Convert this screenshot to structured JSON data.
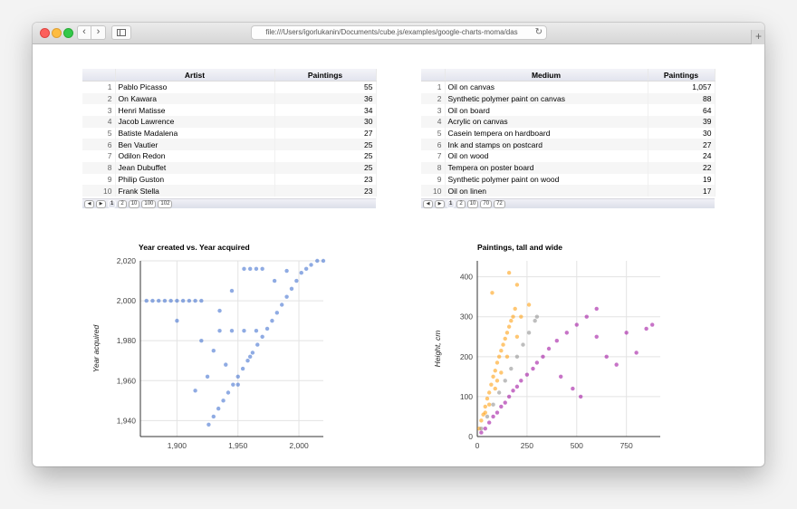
{
  "browser": {
    "url": "file:///Users/igorlukanin/Documents/cube.js/examples/google-charts-moma/das",
    "reload_icon": "reload-icon",
    "new_tab_symbol": "+"
  },
  "artist_table": {
    "headers": [
      "",
      "Artist",
      "Paintings"
    ],
    "rows": [
      [
        "1",
        "Pablo Picasso",
        "55"
      ],
      [
        "2",
        "On Kawara",
        "36"
      ],
      [
        "3",
        "Henri Matisse",
        "34"
      ],
      [
        "4",
        "Jacob Lawrence",
        "30"
      ],
      [
        "5",
        "Batiste Madalena",
        "27"
      ],
      [
        "6",
        "Ben Vautier",
        "25"
      ],
      [
        "7",
        "Odilon Redon",
        "25"
      ],
      [
        "8",
        "Jean Dubuffet",
        "25"
      ],
      [
        "9",
        "Philip Guston",
        "23"
      ],
      [
        "10",
        "Frank Stella",
        "23"
      ]
    ],
    "pages": [
      "1",
      "2",
      "10",
      "100",
      "102"
    ]
  },
  "medium_table": {
    "headers": [
      "",
      "Medium",
      "Paintings"
    ],
    "rows": [
      [
        "1",
        "Oil on canvas",
        "1,057"
      ],
      [
        "2",
        "Synthetic polymer paint on canvas",
        "88"
      ],
      [
        "3",
        "Oil on board",
        "64"
      ],
      [
        "4",
        "Acrylic on canvas",
        "39"
      ],
      [
        "5",
        "Casein tempera on hardboard",
        "30"
      ],
      [
        "6",
        "Ink and stamps on postcard",
        "27"
      ],
      [
        "7",
        "Oil on wood",
        "24"
      ],
      [
        "8",
        "Tempera on poster board",
        "22"
      ],
      [
        "9",
        "Synthetic polymer paint on wood",
        "19"
      ],
      [
        "10",
        "Oil on linen",
        "17"
      ]
    ],
    "pages": [
      "1",
      "2",
      "10",
      "70",
      "72"
    ]
  },
  "chart_data": [
    {
      "type": "scatter",
      "title": "Year created vs. Year acquired",
      "xlabel": "",
      "ylabel": "Year acquired",
      "xlim": [
        1870,
        2020
      ],
      "ylim": [
        1932,
        2020
      ],
      "xticks": [
        "1,900",
        "1,950",
        "2,000"
      ],
      "xtick_values": [
        1900,
        1950,
        2000
      ],
      "yticks": [
        "1,940",
        "1,960",
        "1,980",
        "2,000",
        "2,020"
      ],
      "ytick_values": [
        1940,
        1960,
        1980,
        2000,
        2020
      ],
      "grid": true,
      "color": "#3366cc",
      "series": [
        {
          "points": [
            [
              1875,
              2000
            ],
            [
              1880,
              2000
            ],
            [
              1885,
              2000
            ],
            [
              1890,
              2000
            ],
            [
              1895,
              2000
            ],
            [
              1900,
              2000
            ],
            [
              1905,
              2000
            ],
            [
              1910,
              2000
            ],
            [
              1915,
              2000
            ],
            [
              1920,
              2000
            ],
            [
              1926,
              1938
            ],
            [
              1930,
              1942
            ],
            [
              1934,
              1946
            ],
            [
              1938,
              1950
            ],
            [
              1942,
              1954
            ],
            [
              1946,
              1958
            ],
            [
              1950,
              1962
            ],
            [
              1954,
              1966
            ],
            [
              1958,
              1970
            ],
            [
              1962,
              1974
            ],
            [
              1966,
              1978
            ],
            [
              1970,
              1982
            ],
            [
              1974,
              1986
            ],
            [
              1978,
              1990
            ],
            [
              1982,
              1994
            ],
            [
              1986,
              1998
            ],
            [
              1990,
              2002
            ],
            [
              1994,
              2006
            ],
            [
              1998,
              2010
            ],
            [
              2002,
              2014
            ],
            [
              2006,
              2016
            ],
            [
              2010,
              2018
            ],
            [
              2015,
              2020
            ],
            [
              2020,
              2020
            ],
            [
              1955,
              2016
            ],
            [
              1960,
              2016
            ],
            [
              1965,
              2016
            ],
            [
              1970,
              2016
            ],
            [
              1935,
              1985
            ],
            [
              1945,
              1985
            ],
            [
              1955,
              1985
            ],
            [
              1965,
              1985
            ],
            [
              1930,
              1975
            ],
            [
              1940,
              1968
            ],
            [
              1950,
              1958
            ],
            [
              1960,
              1972
            ],
            [
              1915,
              1955
            ],
            [
              1925,
              1962
            ],
            [
              1935,
              1995
            ],
            [
              1980,
              2010
            ],
            [
              1990,
              2015
            ],
            [
              1945,
              2005
            ],
            [
              1920,
              1980
            ],
            [
              1900,
              1990
            ]
          ]
        }
      ]
    },
    {
      "type": "scatter",
      "title": "Paintings, tall and wide",
      "xlabel": "",
      "ylabel": "Height, cm",
      "xlim": [
        0,
        920
      ],
      "ylim": [
        0,
        440
      ],
      "xticks": [
        "0",
        "250",
        "500",
        "750"
      ],
      "xtick_values": [
        0,
        250,
        500,
        750
      ],
      "yticks": [
        "0",
        "100",
        "200",
        "300",
        "400"
      ],
      "ytick_values": [
        0,
        100,
        200,
        300,
        400
      ],
      "grid": true,
      "series": [
        {
          "color": "#ff9900",
          "points": [
            [
              10,
              20
            ],
            [
              20,
              40
            ],
            [
              30,
              55
            ],
            [
              40,
              75
            ],
            [
              50,
              95
            ],
            [
              60,
              110
            ],
            [
              70,
              130
            ],
            [
              80,
              150
            ],
            [
              90,
              165
            ],
            [
              100,
              185
            ],
            [
              110,
              200
            ],
            [
              120,
              215
            ],
            [
              130,
              230
            ],
            [
              140,
              245
            ],
            [
              150,
              260
            ],
            [
              160,
              275
            ],
            [
              170,
              290
            ],
            [
              180,
              300
            ],
            [
              190,
              320
            ],
            [
              100,
              140
            ],
            [
              150,
              200
            ],
            [
              200,
              250
            ],
            [
              90,
              120
            ],
            [
              60,
              80
            ],
            [
              120,
              160
            ],
            [
              75,
              360
            ],
            [
              160,
              410
            ],
            [
              220,
              300
            ],
            [
              260,
              330
            ],
            [
              200,
              380
            ],
            [
              40,
              60
            ]
          ]
        },
        {
          "color": "#990099",
          "points": [
            [
              20,
              10
            ],
            [
              40,
              20
            ],
            [
              60,
              35
            ],
            [
              80,
              50
            ],
            [
              100,
              60
            ],
            [
              120,
              75
            ],
            [
              140,
              85
            ],
            [
              160,
              100
            ],
            [
              180,
              115
            ],
            [
              200,
              125
            ],
            [
              220,
              140
            ],
            [
              250,
              155
            ],
            [
              280,
              170
            ],
            [
              300,
              185
            ],
            [
              330,
              200
            ],
            [
              360,
              220
            ],
            [
              400,
              240
            ],
            [
              450,
              260
            ],
            [
              500,
              280
            ],
            [
              550,
              300
            ],
            [
              600,
              250
            ],
            [
              650,
              200
            ],
            [
              700,
              180
            ],
            [
              750,
              260
            ],
            [
              800,
              210
            ],
            [
              850,
              270
            ],
            [
              880,
              280
            ],
            [
              420,
              150
            ],
            [
              480,
              120
            ],
            [
              520,
              100
            ],
            [
              600,
              320
            ]
          ]
        },
        {
          "color": "#888888",
          "points": [
            [
              20,
              20
            ],
            [
              50,
              50
            ],
            [
              80,
              80
            ],
            [
              110,
              110
            ],
            [
              140,
              140
            ],
            [
              170,
              170
            ],
            [
              200,
              200
            ],
            [
              230,
              230
            ],
            [
              260,
              260
            ],
            [
              290,
              290
            ],
            [
              300,
              300
            ]
          ]
        }
      ]
    }
  ]
}
